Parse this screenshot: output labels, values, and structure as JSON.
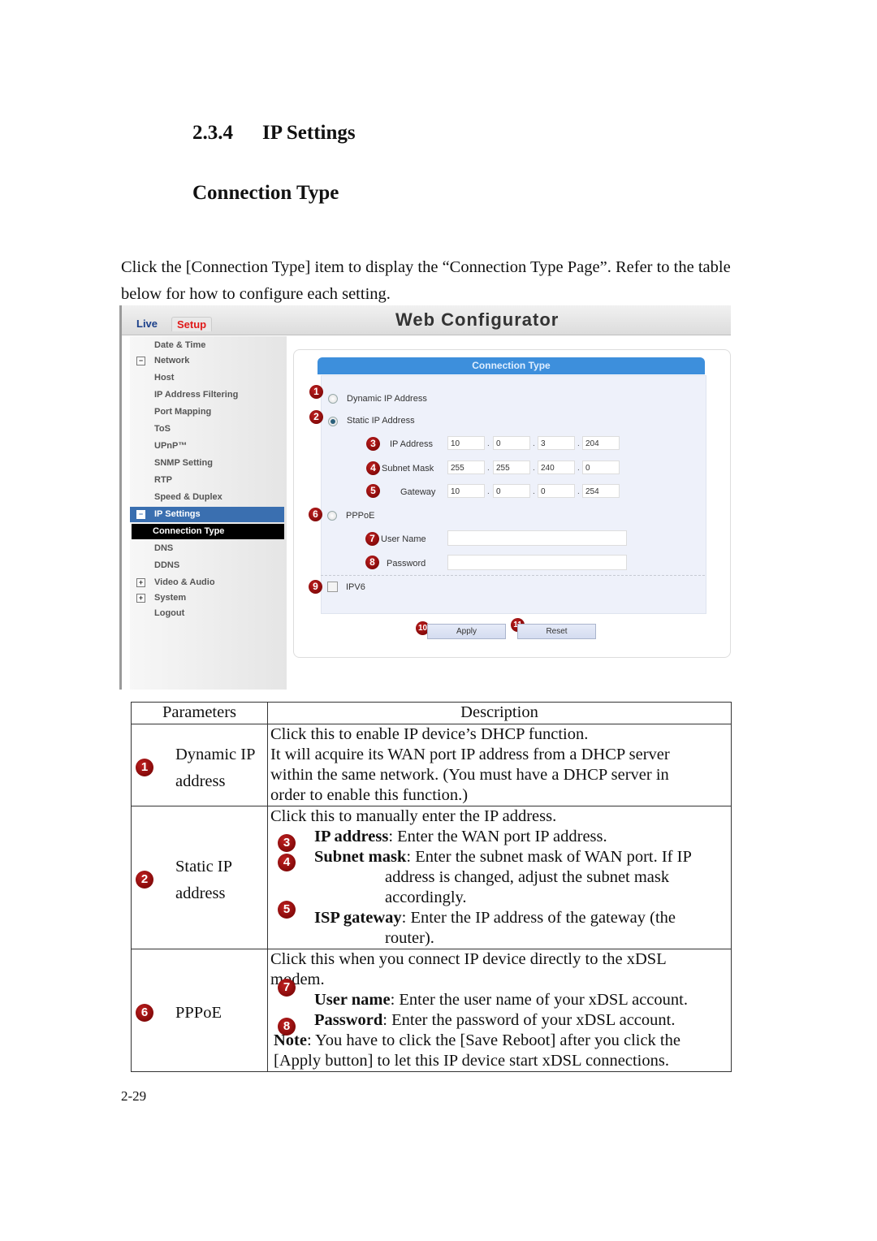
{
  "doc": {
    "section_number": "2.3.4",
    "section_title": "IP Settings",
    "subsection_title": "Connection Type",
    "intro": "Click the [Connection Type] item to display the “Connection Type Page”. Refer to the table below for how to configure each setting.",
    "page_number": "2-29"
  },
  "ui": {
    "app_title": "Web Configurator",
    "tabs": [
      {
        "label": "Live"
      },
      {
        "label": "Setup"
      }
    ],
    "sidebar": {
      "items": [
        {
          "label": "Date & Time"
        },
        {
          "label": "Network",
          "toggle": "−"
        },
        {
          "label": "Host"
        },
        {
          "label": "IP Address Filtering"
        },
        {
          "label": "Port Mapping"
        },
        {
          "label": "ToS"
        },
        {
          "label": "UPnP™"
        },
        {
          "label": "SNMP Setting"
        },
        {
          "label": "RTP"
        },
        {
          "label": "Speed & Duplex"
        },
        {
          "label": "IP Settings",
          "toggle": "−"
        },
        {
          "label": "Connection Type"
        },
        {
          "label": "DNS"
        },
        {
          "label": "DDNS"
        },
        {
          "label": "Video & Audio",
          "toggle": "+"
        },
        {
          "label": "System",
          "toggle": "+"
        },
        {
          "label": "Logout"
        }
      ]
    },
    "panel": {
      "title": "Connection Type",
      "dynamic_label": "Dynamic IP Address",
      "static_label": "Static IP Address",
      "selected_mode": "Static IP Address",
      "ip_label": "IP Address",
      "ip": [
        "10",
        "0",
        "3",
        "204"
      ],
      "mask_label": "Subnet Mask",
      "mask": [
        "255",
        "255",
        "240",
        "0"
      ],
      "gateway_label": "Gateway",
      "gateway": [
        "10",
        "0",
        "0",
        "254"
      ],
      "pppoe_label": "PPPoE",
      "username_label": "User Name",
      "username_value": "",
      "password_label": "Password",
      "password_value": "",
      "ipv6_label": "IPV6",
      "ipv6_checked": false,
      "apply_label": "Apply",
      "reset_label": "Reset",
      "separator": "."
    },
    "badges": [
      "1",
      "2",
      "3",
      "4",
      "5",
      "6",
      "7",
      "8",
      "9",
      "10",
      "11"
    ],
    "badge_color": "#8b0000",
    "accent_color": "#3d8fdc"
  },
  "table": {
    "headers": [
      "Parameters",
      "Description"
    ],
    "rows": [
      {
        "badge": "1",
        "param": [
          "Dynamic IP",
          "address"
        ],
        "lines": [
          "Click this to enable IP device’s DHCP function.",
          "It will acquire its WAN port IP address from a DHCP server",
          "within the same network. (You must have a DHCP server in",
          "order to enable this function.)"
        ]
      },
      {
        "badge": "2",
        "param": [
          "Static IP",
          "address"
        ],
        "intro": "Click this to manually enter the IP address.",
        "items": [
          {
            "badge": "3",
            "term": "IP address",
            "text": ": Enter the WAN port IP address."
          },
          {
            "badge": "4",
            "term": "Subnet mask",
            "text": ": Enter the subnet mask of WAN port. If IP",
            "cont": [
              "address is changed, adjust the subnet mask",
              "accordingly."
            ]
          },
          {
            "badge": "5",
            "term": "ISP gateway",
            "text": ": Enter the IP address of the gateway (the",
            "cont": [
              "router)."
            ]
          }
        ]
      },
      {
        "badge": "6",
        "param": [
          "PPPoE"
        ],
        "intro": "Click this when you connect IP device directly to the xDSL modem.",
        "items": [
          {
            "badge": "7",
            "term": "User name",
            "text": ": Enter the user name of your xDSL account."
          },
          {
            "badge": "8",
            "term": "Password",
            "text": ": Enter the password of your xDSL account."
          }
        ],
        "note_term": "Note",
        "note_text": ": You have to click the [Save Reboot] after you click the",
        "note_cont": "[Apply button] to let this IP device start xDSL connections."
      }
    ]
  }
}
